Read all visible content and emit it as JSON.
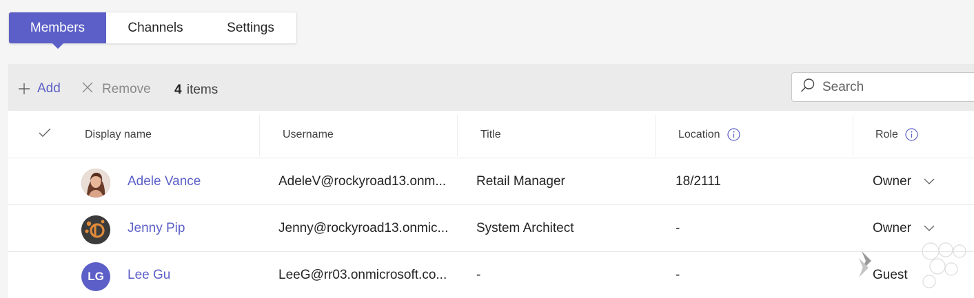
{
  "tabs": [
    {
      "label": "Members",
      "active": true
    },
    {
      "label": "Channels",
      "active": false
    },
    {
      "label": "Settings",
      "active": false
    }
  ],
  "toolbar": {
    "add_label": "Add",
    "remove_label": "Remove",
    "item_count": "4",
    "item_count_suffix": "items"
  },
  "search": {
    "placeholder": "Search"
  },
  "table": {
    "columns": [
      "Display name",
      "Username",
      "Title",
      "Location",
      "Role"
    ],
    "rows": [
      {
        "display_name": "Adele Vance",
        "username": "AdeleV@rockyroad13.onm...",
        "title": "Retail Manager",
        "location": "18/2111",
        "role": "Owner",
        "avatar": "photo"
      },
      {
        "display_name": "Jenny Pip",
        "username": "Jenny@rockyroad13.onmic...",
        "title": "System Architect",
        "location": "-",
        "role": "Owner",
        "avatar": "logo"
      },
      {
        "display_name": "Lee Gu",
        "username": "LeeG@rr03.onmicrosoft.co...",
        "title": "-",
        "location": "-",
        "role": "Guest",
        "avatar": "initials",
        "initials": "LG"
      }
    ]
  },
  "icons": {
    "add": "plus-icon",
    "remove": "close-icon",
    "search": "search-icon",
    "select_all": "checkmark-icon",
    "info": "info-icon",
    "role_dropdown": "chevron-down-icon"
  },
  "colors": {
    "accent": "#5b5fc7",
    "background": "#f5f5f5",
    "toolbar": "#ebebeb",
    "surface": "#ffffff"
  }
}
